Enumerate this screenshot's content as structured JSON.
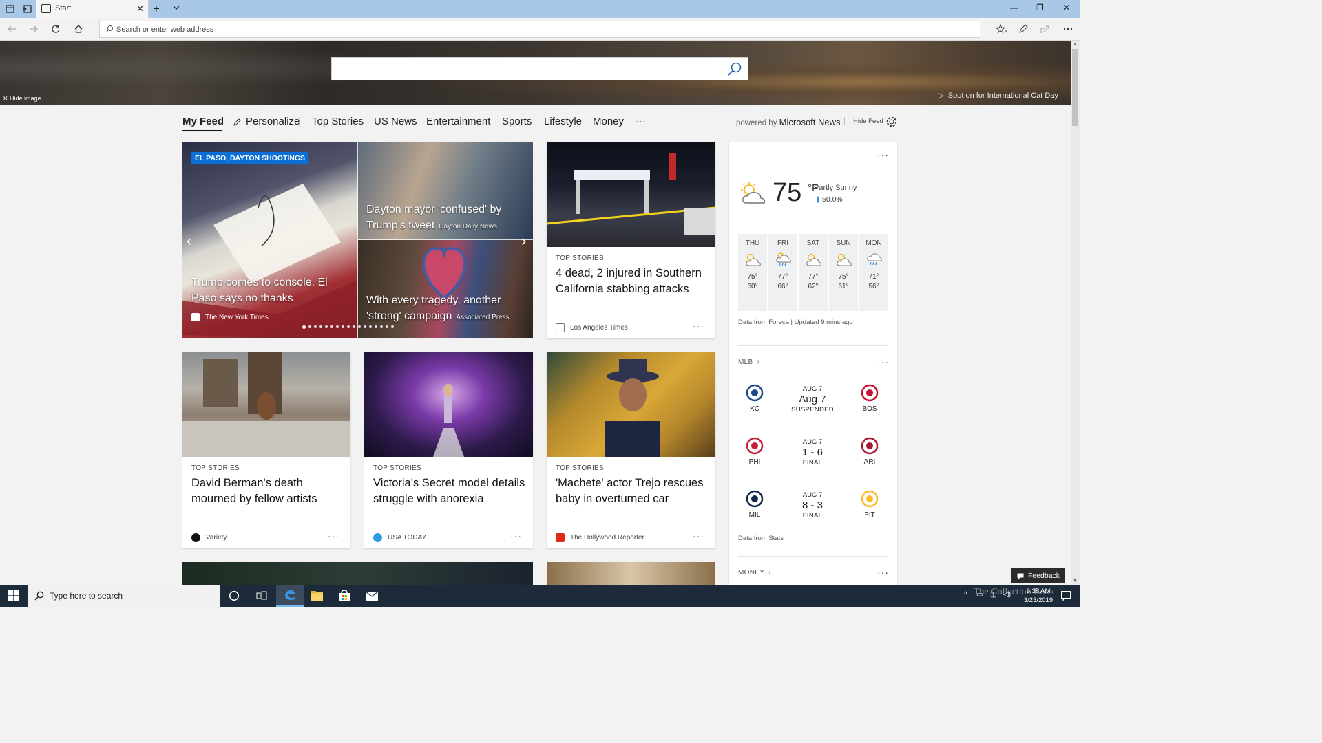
{
  "window": {
    "tab_title": "Start",
    "minimize": "—",
    "restore": "❐",
    "close": "✕"
  },
  "nav": {
    "address_placeholder": "Search or enter web address"
  },
  "hero": {
    "hide_image": "Hide image",
    "caption": "Spot on for International Cat Day"
  },
  "feed_nav": {
    "items": [
      "My Feed",
      "Personalize",
      "Top Stories",
      "US News",
      "Entertainment",
      "Sports",
      "Lifestyle",
      "Money",
      "···"
    ],
    "powered_by_prefix": "powered by",
    "powered_by_brand": "Microsoft News",
    "separator": "|",
    "hide_feed": "Hide Feed"
  },
  "carousel": {
    "badge": "EL PASO, DAYTON SHOOTINGS",
    "main_title": "Trump comes to console. El Paso says no thanks",
    "main_source": "The New York Times",
    "top_right_title": "Dayton mayor 'confused' by Trump's tweet",
    "top_right_source": "Dayton Daily News",
    "bottom_right_title": "With every tragedy, another 'strong' campaign",
    "bottom_right_source": "Associated Press",
    "dot_count": 17,
    "active_dot": 0,
    "prev_arrow": "‹",
    "next_arrow": "›"
  },
  "cards": [
    {
      "category": "TOP STORIES",
      "title": "4 dead, 2 injured in Southern California stabbing attacks",
      "source": "Los Angeles Times",
      "more": "···"
    },
    {
      "category": "TOP STORIES",
      "title": "David Berman's death mourned by fellow artists",
      "source": "Variety",
      "more": "···"
    },
    {
      "category": "TOP STORIES",
      "title": "Victoria's Secret model details struggle with anorexia",
      "source": "USA TODAY",
      "more": "···"
    },
    {
      "category": "TOP STORIES",
      "title": "'Machete' actor Trejo rescues baby in overturned car",
      "source": "The Hollywood Reporter",
      "more": "···"
    }
  ],
  "weather": {
    "more": "···",
    "temp": "75",
    "unit": "°F",
    "condition": "Partly Sunny",
    "precip": "50.0%",
    "days": [
      {
        "name": "THU",
        "hi": "75°",
        "lo": "60°",
        "icon": "partly-sunny-icon"
      },
      {
        "name": "FRI",
        "hi": "77°",
        "lo": "66°",
        "icon": "sun-rain-icon"
      },
      {
        "name": "SAT",
        "hi": "77°",
        "lo": "62°",
        "icon": "partly-sunny-icon"
      },
      {
        "name": "SUN",
        "hi": "75°",
        "lo": "61°",
        "icon": "partly-sunny-icon"
      },
      {
        "name": "MON",
        "hi": "71°",
        "lo": "56°",
        "icon": "rain-cloud-icon"
      }
    ],
    "credit": "Data from Foreca | Updated 9 mins ago"
  },
  "mlb": {
    "label": "MLB",
    "more": "···",
    "games": [
      {
        "away": "KC",
        "home": "BOS",
        "date": "AUG 7",
        "score": "Aug 7",
        "status": "SUSPENDED",
        "away_color": "#1a4a8a",
        "home_color": "#c8102e"
      },
      {
        "away": "PHI",
        "home": "ARI",
        "date": "AUG 7",
        "score": "1 - 6",
        "status": "FINAL",
        "away_color": "#c41e3a",
        "home_color": "#a71930"
      },
      {
        "away": "MIL",
        "home": "PIT",
        "date": "AUG 7",
        "score": "8 - 3",
        "status": "FINAL",
        "away_color": "#12284b",
        "home_color": "#fdb827"
      }
    ],
    "credit": "Data from Stats"
  },
  "money": {
    "label": "MONEY",
    "more": "···"
  },
  "feedback": {
    "label": "Feedback"
  },
  "taskbar": {
    "search_placeholder": "Type here to search",
    "time": "9:38 AM",
    "date": "3/23/2019"
  },
  "watermark": "The Collection Book"
}
